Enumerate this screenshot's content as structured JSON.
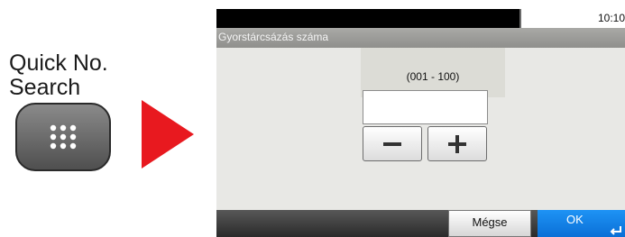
{
  "instruction": {
    "label_line1": "Quick No.",
    "label_line2": "Search",
    "button_icon": "keypad-icon",
    "arrow_icon": "arrow-right-icon"
  },
  "status": {
    "time": "10:10"
  },
  "dialog": {
    "title": "Gyorstárcsázás száma",
    "range_label": "(001 - 100)",
    "input_value": "",
    "minus_icon": "minus-icon",
    "plus_icon": "plus-icon"
  },
  "footer": {
    "cancel_label": "Mégse",
    "ok_label": "OK",
    "ok_icon": "enter-icon"
  },
  "colors": {
    "arrow": "#e8191f",
    "ok_button": "#0a84f0",
    "title_bar": "#9b9b98",
    "status_bar": "#000000"
  }
}
